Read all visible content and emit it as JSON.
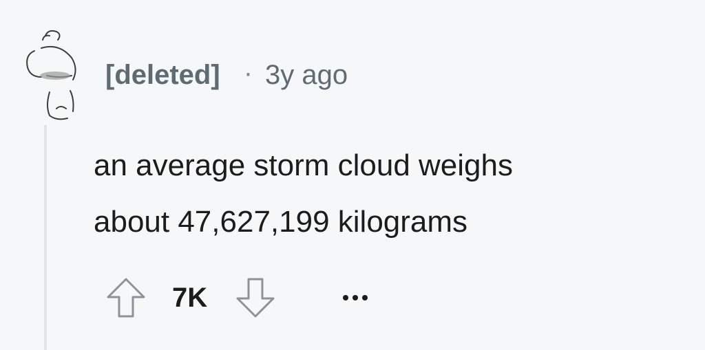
{
  "comment": {
    "author": "[deleted]",
    "separator": "·",
    "timestamp": "3y ago",
    "text_line1": "an average storm cloud weighs",
    "text_line2": "about 47,627,199 kilograms",
    "score": "7K",
    "icons": {
      "avatar": "snoo-avatar-icon",
      "upvote": "arrow-up-icon",
      "downvote": "arrow-down-icon",
      "more": "more-options-icon"
    },
    "colors": {
      "background": "#f6f7f8",
      "meta_text": "#5f6b73",
      "body_text": "#1c1c1c",
      "thread_line": "#e1e4e6",
      "icon_stroke": "#7c868d"
    }
  }
}
